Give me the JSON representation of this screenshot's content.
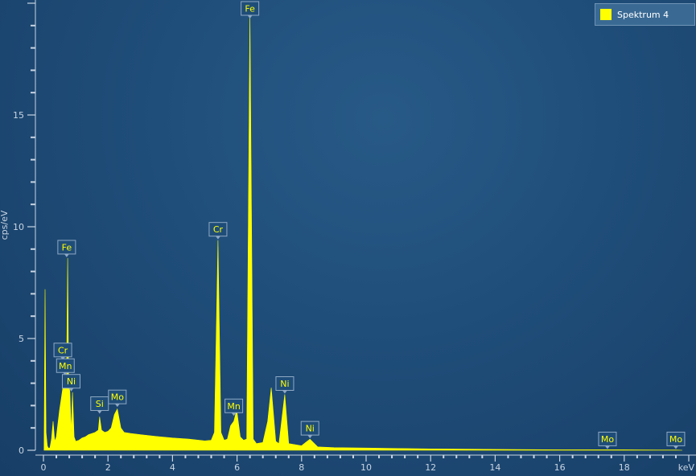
{
  "colors": {
    "spectrum": "#ffff00",
    "axis": "#c9d5e3",
    "label_box": "#1f4d79",
    "label_border": "#8fa9c4"
  },
  "legend": {
    "label": "Spektrum 4"
  },
  "chart_data": {
    "type": "area",
    "title": "",
    "xlabel": "keV",
    "ylabel": "cps/eV",
    "xlim": [
      0,
      20
    ],
    "ylim": [
      0,
      20
    ],
    "x_ticks": [
      0,
      2,
      4,
      6,
      8,
      10,
      12,
      14,
      16,
      18
    ],
    "y_ticks": [
      0,
      5,
      10,
      15
    ],
    "legend_position": "top-right",
    "grid": false,
    "series": [
      {
        "name": "Spektrum 4",
        "x": [
          0.02,
          0.05,
          0.08,
          0.12,
          0.15,
          0.2,
          0.25,
          0.3,
          0.35,
          0.4,
          0.45,
          0.5,
          0.55,
          0.6,
          0.65,
          0.7,
          0.72,
          0.75,
          0.78,
          0.82,
          0.86,
          0.9,
          0.95,
          1.0,
          1.1,
          1.2,
          1.3,
          1.4,
          1.5,
          1.6,
          1.7,
          1.74,
          1.8,
          1.9,
          2.0,
          2.1,
          2.2,
          2.29,
          2.4,
          2.5,
          2.7,
          3.0,
          3.5,
          4.0,
          4.5,
          5.0,
          5.2,
          5.3,
          5.41,
          5.5,
          5.6,
          5.7,
          5.8,
          5.9,
          5.99,
          6.1,
          6.2,
          6.3,
          6.4,
          6.5,
          6.6,
          6.8,
          6.95,
          7.06,
          7.2,
          7.3,
          7.48,
          7.6,
          7.8,
          8.0,
          8.26,
          8.5,
          9.0,
          10.0,
          11.0,
          12.0,
          13.0,
          14.0,
          15.0,
          16.0,
          17.0,
          17.48,
          18.0,
          19.0,
          19.6,
          19.8
        ],
        "y": [
          0,
          7.2,
          0.8,
          0.2,
          0.1,
          0.1,
          0.5,
          1.3,
          0.4,
          0.6,
          1.2,
          1.8,
          2.3,
          2.8,
          3.2,
          3.0,
          4.0,
          8.6,
          3.0,
          2.6,
          0.8,
          2.6,
          0.6,
          0.4,
          0.45,
          0.55,
          0.6,
          0.7,
          0.75,
          0.8,
          0.9,
          1.5,
          0.9,
          0.8,
          0.85,
          1.0,
          1.6,
          1.85,
          1.0,
          0.8,
          0.75,
          0.7,
          0.62,
          0.55,
          0.5,
          0.42,
          0.45,
          0.8,
          9.4,
          0.8,
          0.45,
          0.5,
          1.1,
          1.3,
          1.8,
          0.6,
          0.45,
          0.5,
          19.6,
          0.5,
          0.3,
          0.35,
          1.3,
          2.8,
          0.4,
          0.3,
          2.5,
          0.3,
          0.25,
          0.2,
          0.5,
          0.15,
          0.12,
          0.1,
          0.08,
          0.06,
          0.05,
          0.04,
          0.03,
          0.02,
          0.02,
          0.02,
          0.02,
          0.01,
          0.01,
          0
        ]
      }
    ],
    "peak_labels": [
      {
        "element": "Fe",
        "x": 6.4,
        "y": 19.6
      },
      {
        "element": "Fe",
        "x": 0.72,
        "y": 8.6
      },
      {
        "element": "Cr",
        "x": 5.41,
        "y": 9.4
      },
      {
        "element": "Cr",
        "x": 0.6,
        "y": 4.0
      },
      {
        "element": "Mn",
        "x": 0.68,
        "y": 3.3
      },
      {
        "element": "Ni",
        "x": 0.86,
        "y": 2.6
      },
      {
        "element": "Si",
        "x": 1.74,
        "y": 1.6
      },
      {
        "element": "Mo",
        "x": 2.29,
        "y": 1.9
      },
      {
        "element": "Mn",
        "x": 5.9,
        "y": 1.5
      },
      {
        "element": "Ni",
        "x": 7.48,
        "y": 2.5
      },
      {
        "element": "Ni",
        "x": 8.26,
        "y": 0.5
      },
      {
        "element": "Mo",
        "x": 17.48,
        "y": 0.02
      },
      {
        "element": "Mo",
        "x": 19.6,
        "y": 0.02
      }
    ]
  }
}
